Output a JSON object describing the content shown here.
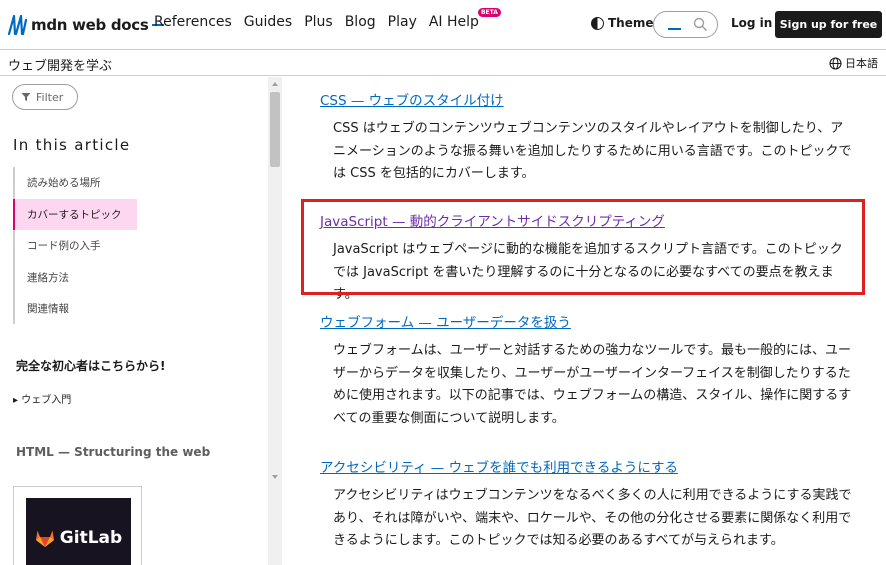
{
  "nav": {
    "logo": "mdn web docs",
    "links": [
      "References",
      "Guides",
      "Plus",
      "Blog",
      "Play",
      "AI Help"
    ],
    "beta_badge": "BETA",
    "theme": "Theme",
    "login": "Log in",
    "signup": "Sign up for free"
  },
  "breadcrumb": {
    "label": "ウェブ開発を学ぶ",
    "language": "日本語"
  },
  "sidebar": {
    "filter": "Filter",
    "toc_title": "In this article",
    "toc_items": [
      "読み始める場所",
      "カバーするトピック",
      "コード例の入手",
      "連絡方法",
      "関連情報"
    ],
    "active_index": 1,
    "beginner_heading": "完全な初心者はこちらから!",
    "web_intro": "ウェブ入門",
    "html_heading": "HTML — Structuring the web",
    "ad_brand": "GitLab"
  },
  "main": {
    "entries": [
      {
        "title": "CSS — ウェブのスタイル付け",
        "desc": "CSS はウェブのコンテンツウェブコンテンツのスタイルやレイアウトを制御したり、アニメーションのような振る舞いを追加したりするために用いる言語です。このトピックでは CSS を包括的にカバーします。"
      },
      {
        "title": "JavaScript — 動的クライアントサイドスクリプティング",
        "desc": "JavaScript はウェブページに動的な機能を追加するスクリプト言語です。このトピックでは JavaScript を書いたり理解するのに十分となるのに必要なすべての要点を教えます。"
      },
      {
        "title": "ウェブフォーム — ユーザーデータを扱う",
        "desc": "ウェブフォームは、ユーザーと対話するための強力なツールです。最も一般的には、ユーザーからデータを収集したり、ユーザーがユーザーインターフェイスを制御したりするために使用されます。以下の記事では、ウェブフォームの構造、スタイル、操作に関するすべての重要な側面について説明します。"
      },
      {
        "title": "アクセシビリティ — ウェブを誰でも利用できるようにする",
        "desc": "アクセシビリティはウェブコンテンツをなるべく多くの人に利用できるようにする実践であり、それは障がいや、端末や、ロケールや、その他の分化させる要素に関係なく利用できるようにします。このトピックでは知る必要のあるすべてが与えられます。"
      }
    ]
  },
  "colors": {
    "link": "#0069c2",
    "visited_link": "#6e2eac",
    "highlight_box": "#e02020",
    "active_toc_bg": "#fdd7f0"
  }
}
